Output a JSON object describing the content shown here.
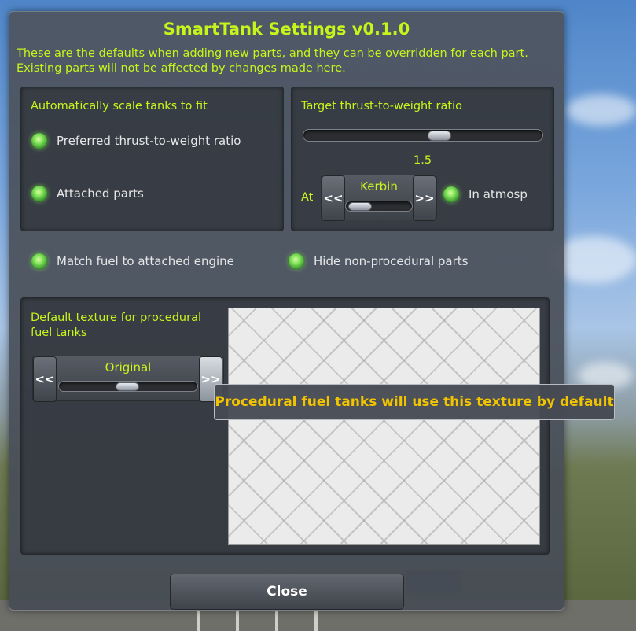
{
  "window": {
    "title": "SmartTank Settings v0.1.0",
    "description": "These are the defaults when adding new parts, and they can be overridden for each part. Existing parts will not be affected by changes made here."
  },
  "scale_panel": {
    "heading": "Automatically scale tanks to fit",
    "toggle_twr": "Preferred thrust-to-weight ratio",
    "toggle_attached": "Attached parts"
  },
  "twr_panel": {
    "heading": "Target thrust-to-weight ratio",
    "twr_value": "1.5",
    "twr_slider_fraction": 0.58,
    "at_label": "At",
    "body_name": "Kerbin",
    "body_slider_fraction": 0.05,
    "prev_label": "<<",
    "next_label": ">>",
    "atmosphere_toggle": "In atmosp"
  },
  "options": {
    "match_fuel": "Match fuel to attached engine",
    "hide_nonprocedural": "Hide non-procedural parts"
  },
  "texture_panel": {
    "heading": "Default texture for procedural fuel tanks",
    "texture_name": "Original",
    "texture_slider_fraction": 0.5,
    "prev_label": "<<",
    "next_label": ">>"
  },
  "tooltip": "Procedural fuel tanks will use this texture by default",
  "close_button": "Close",
  "colors": {
    "accent_green": "#c6f51c",
    "tooltip_text": "#f2c400",
    "led_green": "#7ee05a"
  }
}
